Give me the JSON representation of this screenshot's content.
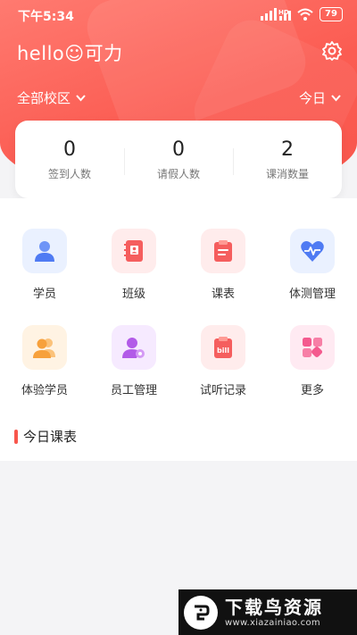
{
  "status_bar": {
    "time": "下午5:34",
    "signal_label": "HD",
    "battery": "79"
  },
  "header": {
    "greeting": "hello☺可力",
    "campus_selector": "全部校区",
    "date_selector": "今日"
  },
  "stats": [
    {
      "value": "0",
      "label": "签到人数"
    },
    {
      "value": "0",
      "label": "请假人数"
    },
    {
      "value": "2",
      "label": "课消数量"
    }
  ],
  "menu": [
    {
      "label": "学员",
      "icon": "student-icon",
      "color": "#4f7bf3",
      "bg": "#eaf1ff"
    },
    {
      "label": "班级",
      "icon": "class-book-icon",
      "color": "#f55e5e",
      "bg": "#ffecec"
    },
    {
      "label": "课表",
      "icon": "schedule-clipboard-icon",
      "color": "#f55e5e",
      "bg": "#ffecec"
    },
    {
      "label": "体测管理",
      "icon": "heart-pulse-icon",
      "color": "#4f7bf3",
      "bg": "#eaf1ff"
    },
    {
      "label": "体验学员",
      "icon": "trial-students-icon",
      "color": "#f7a13c",
      "bg": "#fff3e3"
    },
    {
      "label": "员工管理",
      "icon": "staff-gear-icon",
      "color": "#b25be8",
      "bg": "#f6eaff"
    },
    {
      "label": "试听记录",
      "icon": "audition-record-icon",
      "color": "#f55e5e",
      "bg": "#ffecec"
    },
    {
      "label": "更多",
      "icon": "more-grid-icon",
      "color": "#f45a8e",
      "bg": "#ffeaf2"
    }
  ],
  "section": {
    "title": "今日课表"
  },
  "watermark": {
    "title": "下载鸟资源",
    "url": "www.xiazainiao.com"
  },
  "colors": {
    "accent": "#f8564c"
  }
}
